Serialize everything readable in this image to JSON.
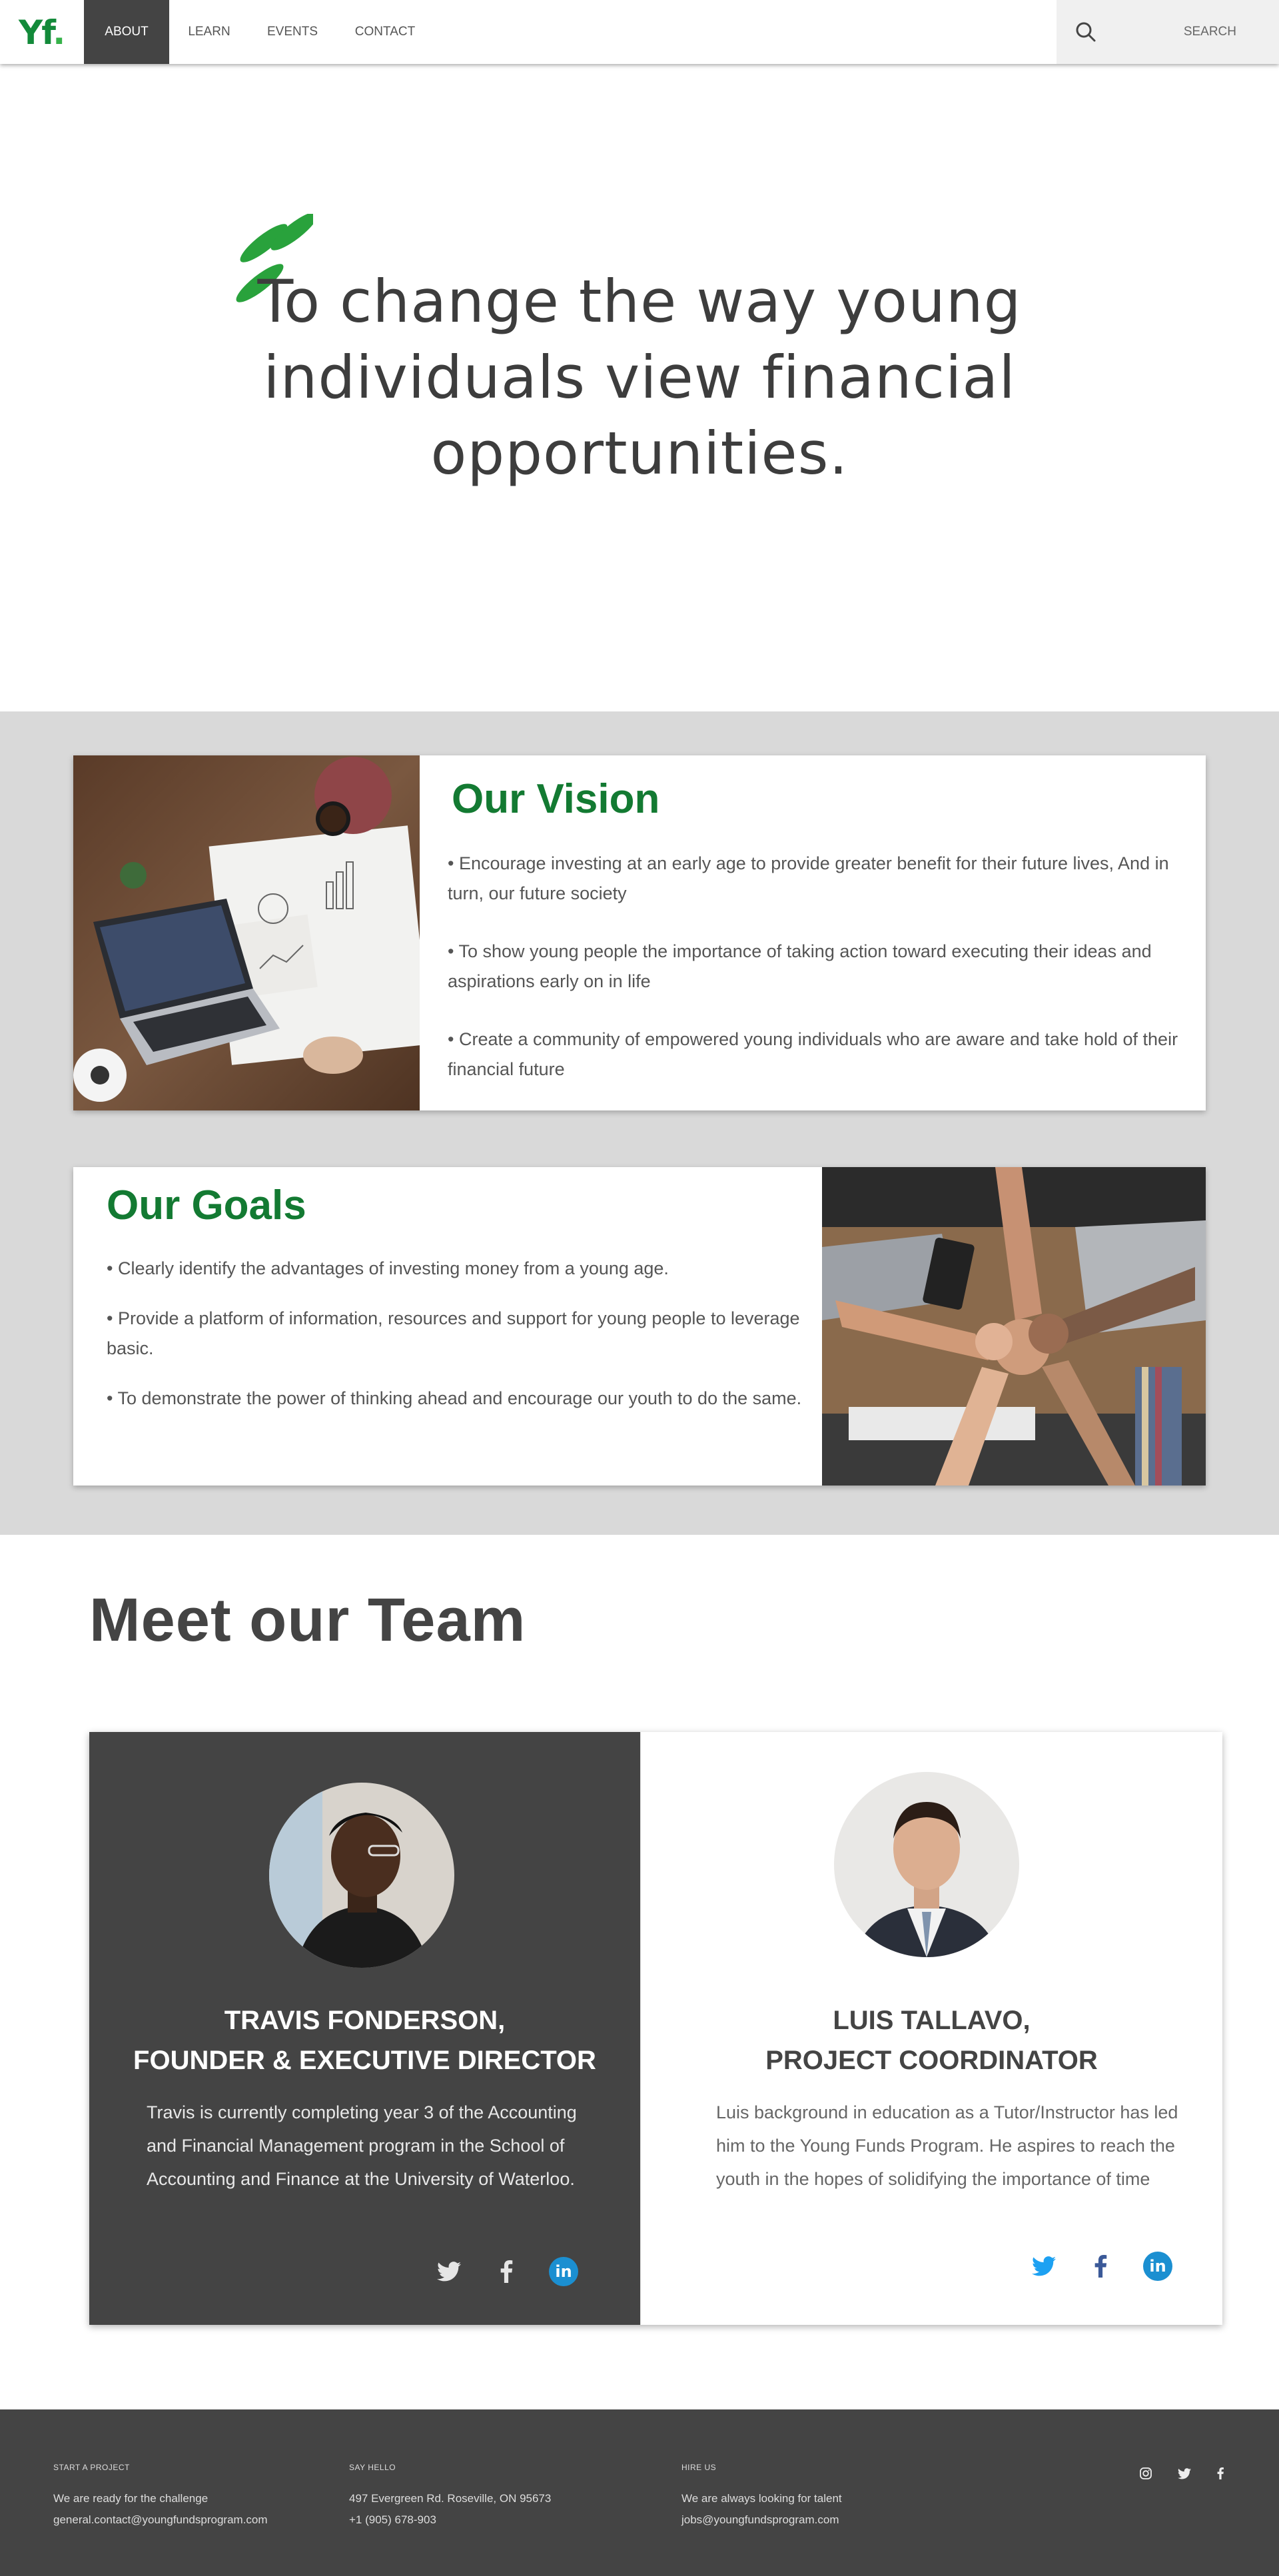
{
  "nav": {
    "logo_text": "Yf",
    "logo_dot": ".",
    "items": [
      {
        "label": "ABOUT"
      },
      {
        "label": "LEARN"
      },
      {
        "label": "EVENTS"
      },
      {
        "label": "CONTACT"
      }
    ],
    "search_label": "SEARCH"
  },
  "hero": {
    "mission": "To change the way young individuals view financial opportunities."
  },
  "vision": {
    "title": "Our Vision",
    "items": [
      "• Encourage investing at an early age to provide greater benefit for their future lives, And in turn, our future society",
      "• To show young people the importance of taking action toward executing their ideas and aspirations early on in life",
      "• Create a community of empowered young individuals who are aware and take hold of their financial future"
    ]
  },
  "goals": {
    "title": "Our Goals",
    "items": [
      "• Clearly identify the advantages of investing money from a young age.",
      "• Provide a platform of information, resources and support for young people to leverage basic.",
      "• To demonstrate the power of thinking ahead and encourage our youth to do the same."
    ]
  },
  "team": {
    "title": "Meet our Team",
    "members": [
      {
        "name": "TRAVIS FONDERSON,",
        "role": "FOUNDER & EXECUTIVE DIRECTOR",
        "bio": "Travis is currently completing year 3 of the Accounting and Financial Management program in the School of Accounting and Finance at the University of Waterloo."
      },
      {
        "name": "LUIS TALLAVO,",
        "role": "PROJECT COORDINATOR",
        "bio": "Luis background in education as a Tutor/Instructor has led him to the Young Funds Program. He aspires to reach the youth in the hopes of solidifying the importance of time"
      }
    ],
    "linkedin_label": "in"
  },
  "footer": {
    "col1": {
      "heading": "START A PROJECT",
      "line1": "We are ready for the challenge",
      "line2": "general.contact@youngfundsprogram.com"
    },
    "col2": {
      "heading": "SAY HELLO",
      "line1": "497 Evergreen Rd. Roseville, ON 95673",
      "line2": "+1 (905) 678-903"
    },
    "col3": {
      "heading": "HIRE US",
      "line1": "We are always looking for talent",
      "line2": "jobs@youngfundsprogram.com"
    }
  },
  "colors": {
    "brand_green": "#137a32",
    "dark_grey": "#444444",
    "section_grey": "#d9d9d9",
    "twitter_blue": "#1da1f2",
    "facebook_blue": "#3b5998",
    "linkedin_blue": "#1b8fd1"
  },
  "icons": [
    "search-icon",
    "quote-mark-icon",
    "twitter-icon",
    "facebook-icon",
    "linkedin-icon",
    "instagram-icon"
  ]
}
